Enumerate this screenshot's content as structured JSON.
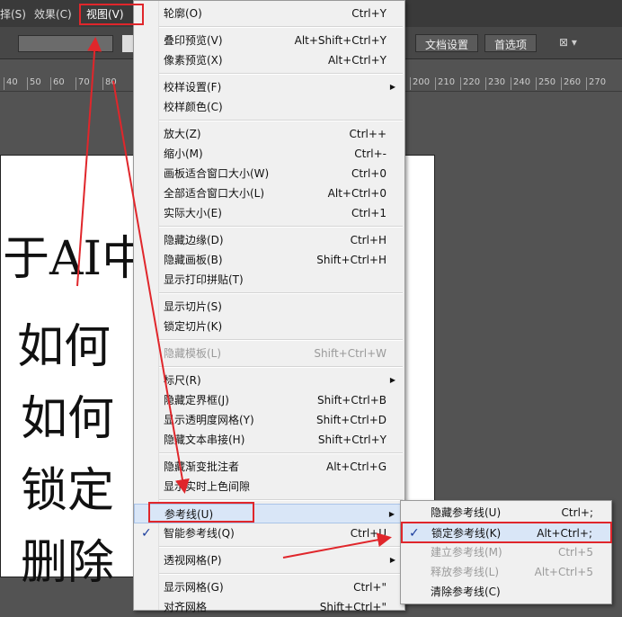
{
  "menubar": {
    "items": [
      "择(S)",
      "效果(C)",
      "视图(V)"
    ]
  },
  "toolbar": {
    "doc_settings": "文档设置",
    "preferences": "首选项"
  },
  "ruler": {
    "ticks": [
      "40",
      "50",
      "60",
      "70",
      "80",
      "200",
      "210",
      "220",
      "230",
      "240",
      "250",
      "260",
      "270"
    ]
  },
  "artboard": {
    "lines": [
      "于AI中",
      "如何",
      "如何",
      "锁定",
      "删除"
    ]
  },
  "menu": {
    "items": [
      {
        "label": "轮廓(O)",
        "shortcut": "Ctrl+Y"
      },
      {
        "sep": true
      },
      {
        "label": "叠印预览(V)",
        "shortcut": "Alt+Shift+Ctrl+Y"
      },
      {
        "label": "像素预览(X)",
        "shortcut": "Alt+Ctrl+Y"
      },
      {
        "sep": true
      },
      {
        "label": "校样设置(F)",
        "submenu": true
      },
      {
        "label": "校样颜色(C)"
      },
      {
        "sep": true
      },
      {
        "label": "放大(Z)",
        "shortcut": "Ctrl++"
      },
      {
        "label": "缩小(M)",
        "shortcut": "Ctrl+-"
      },
      {
        "label": "画板适合窗口大小(W)",
        "shortcut": "Ctrl+0"
      },
      {
        "label": "全部适合窗口大小(L)",
        "shortcut": "Alt+Ctrl+0"
      },
      {
        "label": "实际大小(E)",
        "shortcut": "Ctrl+1"
      },
      {
        "sep": true
      },
      {
        "label": "隐藏边缘(D)",
        "shortcut": "Ctrl+H"
      },
      {
        "label": "隐藏画板(B)",
        "shortcut": "Shift+Ctrl+H"
      },
      {
        "label": "显示打印拼贴(T)"
      },
      {
        "sep": true
      },
      {
        "label": "显示切片(S)"
      },
      {
        "label": "锁定切片(K)"
      },
      {
        "sep": true
      },
      {
        "label": "隐藏模板(L)",
        "shortcut": "Shift+Ctrl+W",
        "disabled": true
      },
      {
        "sep": true
      },
      {
        "label": "标尺(R)",
        "submenu": true
      },
      {
        "label": "隐藏定界框(J)",
        "shortcut": "Shift+Ctrl+B"
      },
      {
        "label": "显示透明度网格(Y)",
        "shortcut": "Shift+Ctrl+D"
      },
      {
        "label": "隐藏文本串接(H)",
        "shortcut": "Shift+Ctrl+Y"
      },
      {
        "sep": true
      },
      {
        "label": "隐藏渐变批注者",
        "shortcut": "Alt+Ctrl+G"
      },
      {
        "label": "显示实时上色间隙"
      },
      {
        "sep": true
      },
      {
        "label": "参考线(U)",
        "submenu": true,
        "highlighted": true
      },
      {
        "label": "智能参考线(Q)",
        "shortcut": "Ctrl+U",
        "checked": true
      },
      {
        "sep": true
      },
      {
        "label": "透视网格(P)",
        "submenu": true
      },
      {
        "sep": true
      },
      {
        "label": "显示网格(G)",
        "shortcut": "Ctrl+\""
      },
      {
        "label": "对齐网格",
        "shortcut": "Shift+Ctrl+\""
      }
    ]
  },
  "submenu": {
    "items": [
      {
        "label": "隐藏参考线(U)",
        "shortcut": "Ctrl+;"
      },
      {
        "label": "锁定参考线(K)",
        "shortcut": "Alt+Ctrl+;",
        "checked": true,
        "highlighted": true
      },
      {
        "label": "建立参考线(M)",
        "shortcut": "Ctrl+5",
        "disabled": true
      },
      {
        "label": "释放参考线(L)",
        "shortcut": "Alt+Ctrl+5",
        "disabled": true
      },
      {
        "label": "清除参考线(C)"
      }
    ]
  },
  "colors": {
    "annotation": "#e0262b",
    "highlight": "#d9e6f7"
  }
}
